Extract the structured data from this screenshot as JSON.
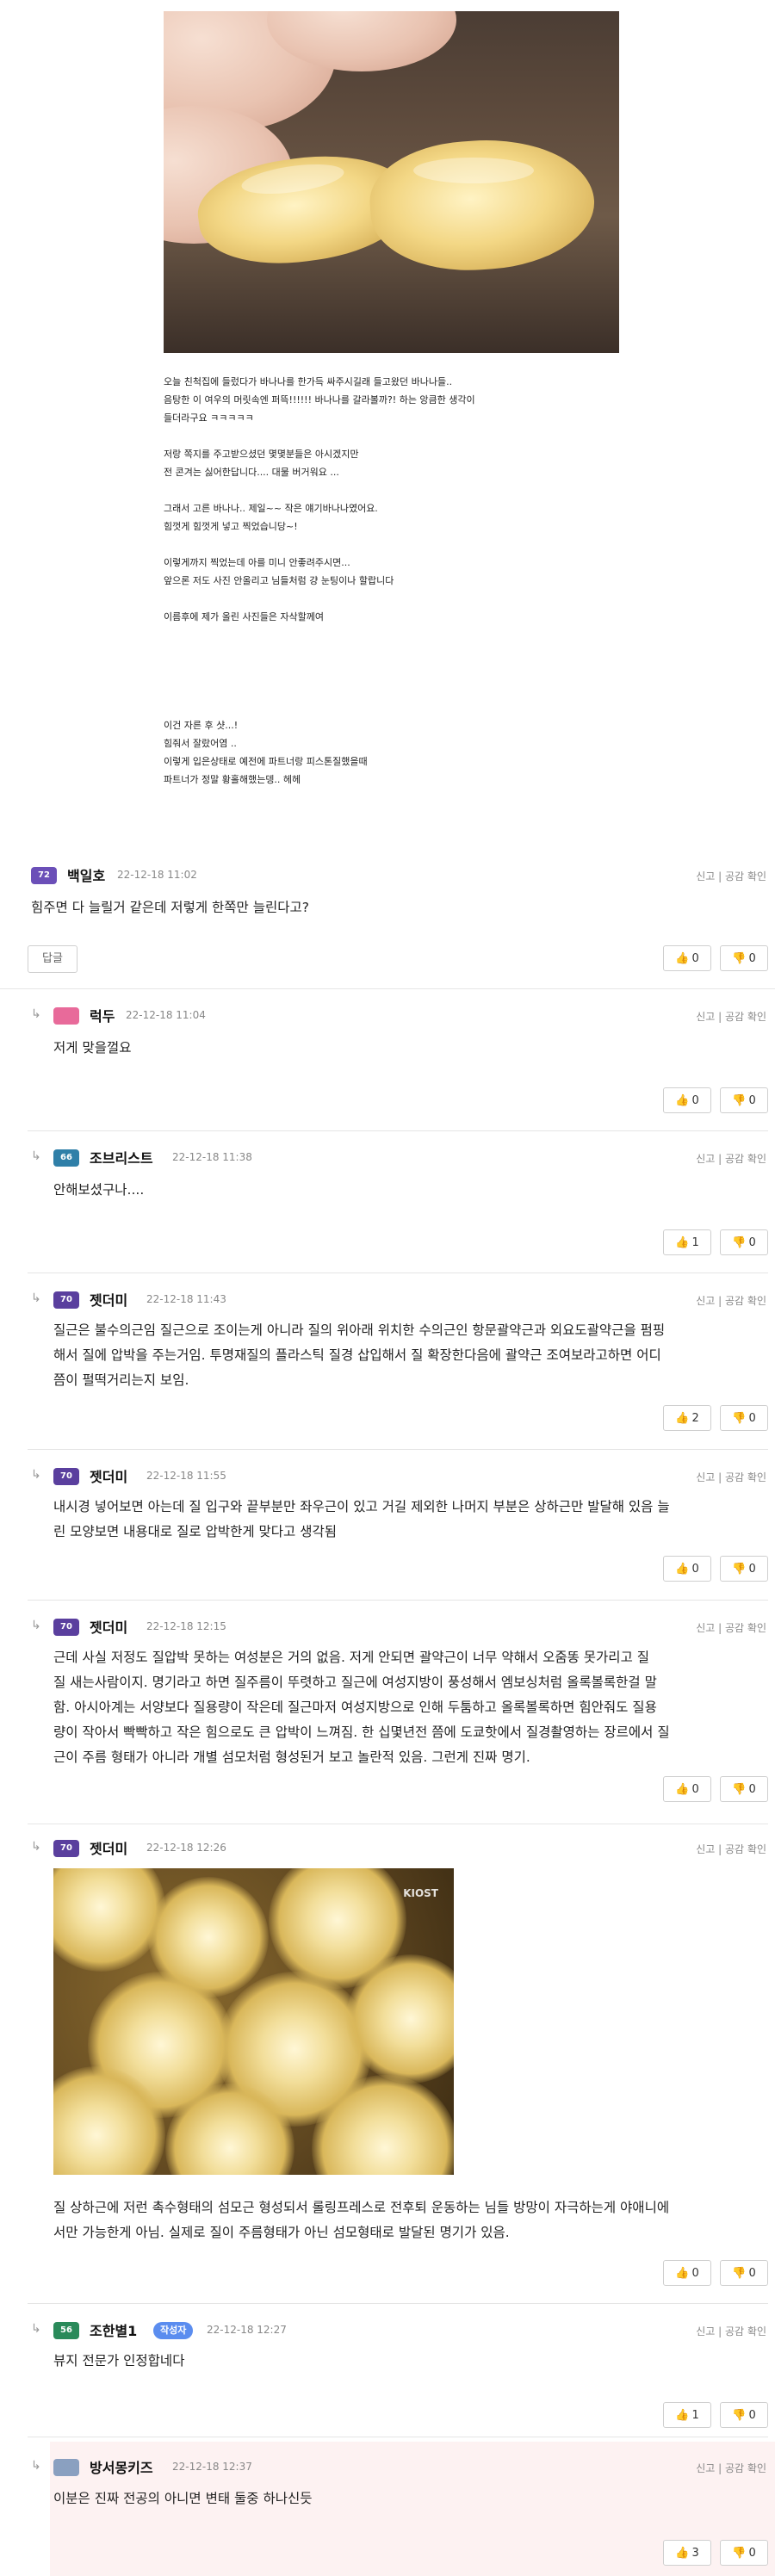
{
  "article": {
    "lines": [
      "오늘 친척집에 들렀다가 바나나를 한가득 싸주시길래 들고왔던 바나나들..",
      "음탕한 이 여우의 머릿속엔 퍼뜩!!!!!! 바나나를 갈라볼까?! 하는 앙큼한 생각이",
      "들더라구요 ㅋㅋㅋㅋㅋ",
      "",
      "저랑 쪽지를 주고받으셨던 몇몇분들은 아시겠지만",
      "전 콘겨는 싫어한답니다.... 대물 버거워요 ...",
      "",
      "그래서 고른 바나나.. 제일~~ 작은 얘기바나나였어요.",
      "힘껏게 힘껏게 넣고 찍었습니당~!",
      "",
      "이렇게까지 찍었는데 아를 미니 안좋려주시면...",
      "앞으론 저도 사진 안올리고 님들처럼 걍 눈팅이나 할랍니다",
      "",
      "이름후에 제가 올린 사진들은 자삭할께여",
      "",
      "",
      "",
      "",
      "",
      "이건 자른 후 샷...!",
      "힘줘서 잘랐어염 ..",
      "이렇게 입은상태로 예전에 파트너랑 피스톤질했을때",
      "파트너가 정말 황홀해했는뎅.. 헤헤"
    ]
  },
  "ui": {
    "report": "신고",
    "sympathy": "공감 확인",
    "reply_button": "답글",
    "up_icon": "👍",
    "down_icon": "👎",
    "op_label": "작성자"
  },
  "comments": [
    {
      "level": "72",
      "badge_color": "#6b4fb8",
      "nick": "백일호",
      "date": "22-12-18 11:02",
      "body": [
        "힘주면 다 늘릴거 같은데 저렇게 한쪽만 늘린다고?"
      ],
      "up": "0",
      "down": "0"
    },
    {
      "level": "",
      "badge_color": "#e86a9a",
      "nick": "럭두",
      "date": "22-12-18 11:04",
      "body": [
        "저게 맞을껄요"
      ],
      "up": "0",
      "down": "0"
    },
    {
      "level": "66",
      "badge_color": "#2f7fa8",
      "nick": "조브리스트",
      "date": "22-12-18 11:38",
      "body": [
        "안해보셨구나...."
      ],
      "up": "1",
      "down": "0"
    },
    {
      "level": "70",
      "badge_color": "#5a3f9e",
      "nick": "젯더미",
      "date": "22-12-18 11:43",
      "body": [
        "질근은 불수의근임 질근으로 조이는게 아니라 질의 위아래 위치한 수의근인 항문괄약근과 외요도괄약근을 펌핑",
        "해서 질에 압박을 주는거임. 투명재질의 플라스틱 질경 삽입해서 질 확장한다음에 괄약근 조여보라고하면 어디",
        "쯤이 펄떡거리는지 보임."
      ],
      "up": "2",
      "down": "0"
    },
    {
      "level": "70",
      "badge_color": "#5a3f9e",
      "nick": "젯더미",
      "date": "22-12-18 11:55",
      "body": [
        "내시경 넣어보면 아는데 질 입구와 끝부분만 좌우근이 있고 거길 제외한 나머지 부분은 상하근만 발달해 있음 늘",
        "린 모양보면 내용대로 질로 압박한게 맞다고 생각됨"
      ],
      "up": "0",
      "down": "0"
    },
    {
      "level": "70",
      "badge_color": "#5a3f9e",
      "nick": "젯더미",
      "date": "22-12-18 12:15",
      "body": [
        "근데 사실 저정도 질압박 못하는 여성분은 거의 없음. 저게 안되면 괄약근이 너무 약해서 오줌똥 못가리고 질",
        "질 새는사람이지. 명기라고 하면 질주름이 뚜렷하고 질근에 여성지방이 풍성해서 엠보싱처럼 올록볼록한걸 말",
        "함. 아시아계는 서양보다 질용량이 작은데 질근마저 여성지방으로 인해 두툼하고 올록볼록하면 힘안줘도 질용",
        "량이 작아서 빡빡하고 작은 힘으로도 큰 압박이 느껴짐. 한 십몇년전 쯤에 도쿄핫에서 질경촬영하는 장르에서 질",
        "근이 주름 형태가 아니라 개별 섬모처럼 형성된거 보고 놀란적 있음. 그런게 진짜 명기."
      ],
      "up": "0",
      "down": "0"
    },
    {
      "level": "70",
      "badge_color": "#5a3f9e",
      "nick": "젯더미",
      "date": "22-12-18 12:26",
      "image_logo": "KIOST",
      "body": [
        "질 상하근에 저런 촉수형태의 섬모근 형성되서 롤링프레스로 전후퇴 운동하는 님들 방망이 자극하는게 야애니에",
        "서만 가능한게 아님. 실제로 질이 주름형태가 아닌 섬모형태로 발달된 명기가 있음."
      ],
      "up": "0",
      "down": "0"
    },
    {
      "level": "56",
      "badge_color": "#2a8a5a",
      "nick": "조한별1",
      "date": "22-12-18 12:27",
      "op": true,
      "body": [
        "뷰지 전문가 인정합네다"
      ],
      "up": "1",
      "down": "0"
    },
    {
      "level": "",
      "badge_color": "#8aa0c0",
      "nick": "방서몽키즈",
      "date": "22-12-18 12:37",
      "body": [
        "이분은 진짜 전공의 아니면 변태 둘중 하나신듯"
      ],
      "up": "3",
      "down": "0"
    }
  ]
}
